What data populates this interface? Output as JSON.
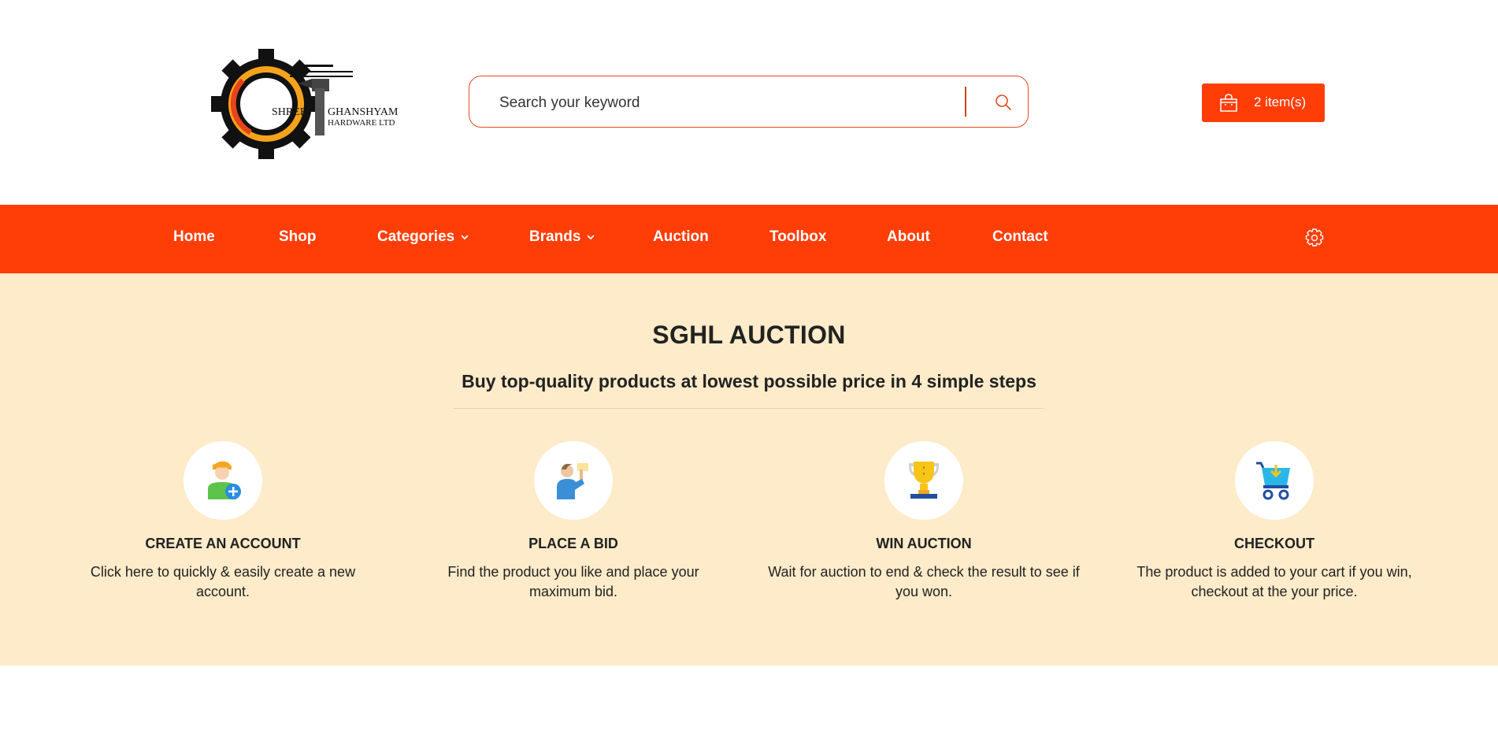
{
  "brand": {
    "logo_text_line1": "SHREE",
    "logo_text_line2": "GHANSHYAM",
    "logo_text_line3": "HARDWARE LTD"
  },
  "search": {
    "placeholder": "Search your keyword",
    "icon": "search-icon"
  },
  "cart": {
    "label": "2 item(s)",
    "icon": "shopping-bag-icon"
  },
  "nav": {
    "items": [
      {
        "label": "Home"
      },
      {
        "label": "Shop"
      },
      {
        "label": "Categories",
        "has_dropdown": true
      },
      {
        "label": "Brands",
        "has_dropdown": true
      },
      {
        "label": "Auction"
      },
      {
        "label": "Toolbox"
      },
      {
        "label": "About"
      },
      {
        "label": "Contact"
      }
    ],
    "settings_icon": "gear-icon"
  },
  "auction": {
    "title": "SGHL AUCTION",
    "subtitle": "Buy top-quality products at lowest possible price in 4 simple steps",
    "steps": [
      {
        "icon": "add-user-icon",
        "title": "CREATE AN ACCOUNT",
        "desc": "Click here to quickly & easily create a new account."
      },
      {
        "icon": "bid-icon",
        "title": "PLACE A BID",
        "desc": "Find the product you like and place your maximum bid."
      },
      {
        "icon": "trophy-icon",
        "title": "WIN AUCTION",
        "desc": "Wait for auction to end & check the result to see if you won."
      },
      {
        "icon": "cart-icon",
        "title": "CHECKOUT",
        "desc": "The product is added to your cart if you win, checkout at the your price."
      }
    ]
  },
  "colors": {
    "accent": "#ff3d06",
    "section_bg": "#fdebc9",
    "text": "#222222"
  }
}
